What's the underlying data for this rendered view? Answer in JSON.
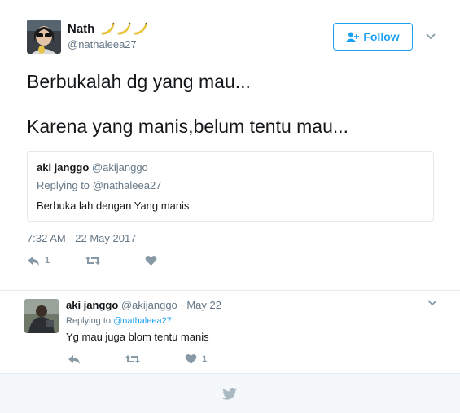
{
  "tweet": {
    "author_name": "Nath",
    "author_handle": "@nathaleea27",
    "follow_label": "Follow",
    "text_line1": "Berbukalah dg yang mau...",
    "text_line2": "Karena yang manis,belum tentu mau...",
    "timestamp": "7:32 AM - 22 May 2017",
    "reply_count": "1",
    "retweet_count": "",
    "like_count": ""
  },
  "quoted": {
    "name": "aki janggo",
    "handle": "@akijanggo",
    "replying_to": "Replying to @nathaleea27",
    "text": "Berbuka lah dengan Yang manis"
  },
  "reply": {
    "name": "aki janggo",
    "handle": "@akijanggo",
    "date": "· May 22",
    "replying_prefix": "Replying to",
    "replying_handle": "@nathaleea27",
    "text": "Yg mau juga blom tentu manis",
    "reply_count": "",
    "retweet_count": "",
    "like_count": "1"
  },
  "colors": {
    "accent": "#1da1f2",
    "muted": "#657786",
    "icon": "#8899a6",
    "border": "#e6ecf0",
    "footer_bg": "#f5f8fa"
  },
  "icons": [
    "banana-emoji-icon",
    "follow-person-icon",
    "chevron-down-icon",
    "reply-icon",
    "retweet-icon",
    "like-heart-icon",
    "twitter-bird-icon"
  ]
}
